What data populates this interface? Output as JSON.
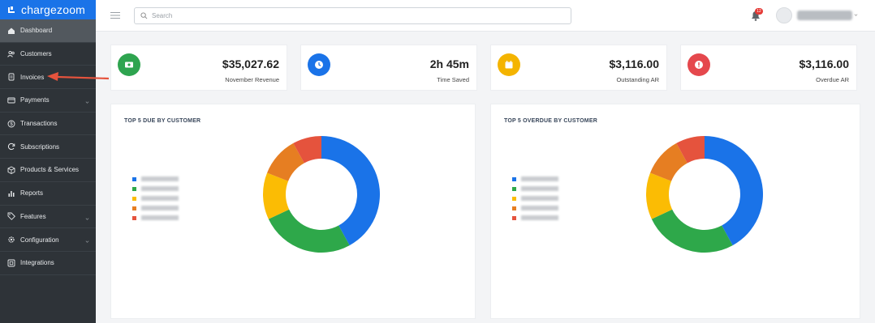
{
  "brand": {
    "name": "chargezoom"
  },
  "sidebar": {
    "items": [
      {
        "label": "Dashboard",
        "icon": "dashboard-icon",
        "active": true,
        "chevron": false
      },
      {
        "label": "Customers",
        "icon": "users-icon",
        "active": false,
        "chevron": false
      },
      {
        "label": "Invoices",
        "icon": "invoice-icon",
        "active": false,
        "chevron": false
      },
      {
        "label": "Payments",
        "icon": "credit-card-icon",
        "active": false,
        "chevron": true
      },
      {
        "label": "Transactions",
        "icon": "dollar-circle-icon",
        "active": false,
        "chevron": false
      },
      {
        "label": "Subscriptions",
        "icon": "refresh-icon",
        "active": false,
        "chevron": false
      },
      {
        "label": "Products & Services",
        "icon": "box-icon",
        "active": false,
        "chevron": false
      },
      {
        "label": "Reports",
        "icon": "bar-chart-icon",
        "active": false,
        "chevron": false
      },
      {
        "label": "Features",
        "icon": "tag-icon",
        "active": false,
        "chevron": true
      },
      {
        "label": "Configuration",
        "icon": "gear-icon",
        "active": false,
        "chevron": true
      },
      {
        "label": "Integrations",
        "icon": "integrations-icon",
        "active": false,
        "chevron": false
      }
    ]
  },
  "topbar": {
    "search_placeholder": "Search",
    "notification_count": "12",
    "username": "blurred"
  },
  "stats": [
    {
      "value": "$35,027.62",
      "label": "November Revenue",
      "color": "#2ea44f",
      "icon": "money-icon"
    },
    {
      "value": "2h 45m",
      "label": "Time Saved",
      "color": "#1a73e8",
      "icon": "clock-icon"
    },
    {
      "value": "$3,116.00",
      "label": "Outstanding AR",
      "color": "#f4b400",
      "icon": "calendar-icon"
    },
    {
      "value": "$3,116.00",
      "label": "Overdue AR",
      "color": "#e5484d",
      "icon": "alert-icon"
    }
  ],
  "panels": [
    {
      "title": "TOP 5 DUE BY CUSTOMER",
      "legend": [
        "Customer A",
        "Customer B",
        "Customer C",
        "Customer D",
        "Customer E"
      ]
    },
    {
      "title": "TOP 5 OVERDUE BY CUSTOMER",
      "legend": [
        "Customer A",
        "Customer B",
        "Customer C",
        "Customer D",
        "Customer E"
      ]
    }
  ],
  "chart_data": [
    {
      "type": "pie",
      "title": "TOP 5 DUE BY CUSTOMER",
      "categories": [
        "Customer 1",
        "Customer 2",
        "Customer 3",
        "Customer 4",
        "Customer 5"
      ],
      "values": [
        42,
        26,
        13,
        11,
        8
      ],
      "colors": [
        "#1a73e8",
        "#2ea84a",
        "#fbbc04",
        "#e67e22",
        "#e5533d"
      ],
      "donut": true,
      "legend_position": "left"
    },
    {
      "type": "pie",
      "title": "TOP 5 OVERDUE BY CUSTOMER",
      "categories": [
        "Customer 1",
        "Customer 2",
        "Customer 3",
        "Customer 4",
        "Customer 5"
      ],
      "values": [
        42,
        26,
        13,
        11,
        8
      ],
      "colors": [
        "#1a73e8",
        "#2ea84a",
        "#fbbc04",
        "#e67e22",
        "#e5533d"
      ],
      "donut": true,
      "legend_position": "left"
    }
  ]
}
